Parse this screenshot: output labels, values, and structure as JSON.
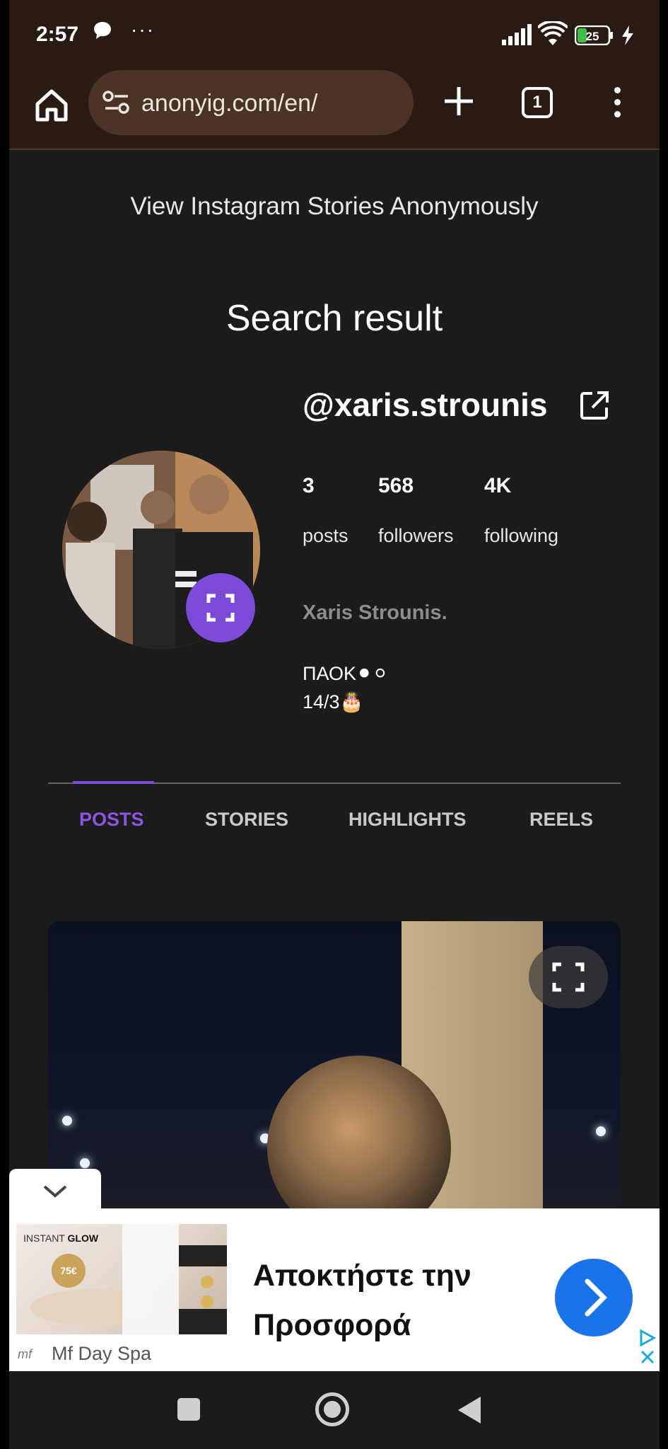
{
  "status_bar": {
    "time": "2:57",
    "battery": "25",
    "icons": [
      "chat-bubble-icon",
      "more-dots-icon",
      "signal-icon",
      "wifi-icon",
      "battery-icon",
      "charging-bolt-icon"
    ]
  },
  "browser": {
    "url": "anonyig.com/en/",
    "tab_count": "1"
  },
  "page": {
    "tagline": "View Instagram Stories Anonymously",
    "section_title": "Search result"
  },
  "profile": {
    "username": "@xaris.strounis",
    "full_name": "Xaris Strounis.",
    "bio": "ΠΑΟΚ⚫⚪\n14/3🎂",
    "stats": [
      {
        "value": "3",
        "label": "posts"
      },
      {
        "value": "568",
        "label": "followers"
      },
      {
        "value": "4K",
        "label": "following"
      }
    ]
  },
  "tabs": [
    {
      "label": "POSTS",
      "active": true
    },
    {
      "label": "STORIES",
      "active": false
    },
    {
      "label": "HIGHLIGHTS",
      "active": false
    },
    {
      "label": "REELS",
      "active": false
    }
  ],
  "ad": {
    "image_caption_prefix": "INSTANT ",
    "image_caption_bold": "GLOW",
    "image_badge": "75€",
    "headline": "Αποκτήστε την\nΠροσφορά",
    "advertiser": "Mf Day Spa",
    "advertiser_logo": "mf"
  },
  "colors": {
    "accent": "#7b4bd8",
    "tab_active": "#8a55e0",
    "background": "#1b1b1b",
    "browser_chrome": "#2a1a14",
    "ad_cta": "#1a73e8"
  }
}
